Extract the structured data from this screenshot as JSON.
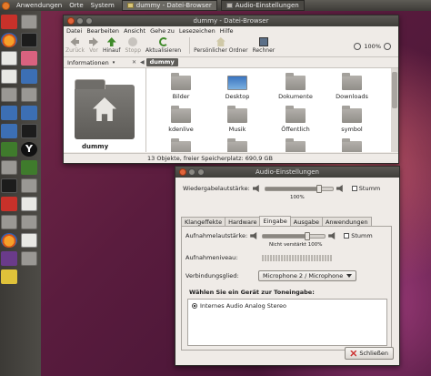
{
  "top_panel": {
    "menus": [
      "Anwendungen",
      "Orte",
      "System"
    ],
    "tasks": [
      {
        "label": "dummy - Datei-Browser",
        "active": true
      },
      {
        "label": "Audio-Einstellungen",
        "active": false
      }
    ]
  },
  "file_browser": {
    "title": "dummy - Datei-Browser",
    "menu": [
      "Datei",
      "Bearbeiten",
      "Ansicht",
      "Gehe zu",
      "Lesezeichen",
      "Hilfe"
    ],
    "toolbar": {
      "back": "Zurück",
      "forward": "Vor",
      "up": "Hinauf",
      "stop": "Stopp",
      "reload": "Aktualisieren",
      "home": "Persönlicher Ordner",
      "computer": "Rechner",
      "zoom": "100%"
    },
    "side_label": "Informationen",
    "breadcrumb": "dummy",
    "side_caption": "dummy",
    "files": [
      {
        "name": "Bilder",
        "icon": "folder-icon"
      },
      {
        "name": "Desktop",
        "icon": "image-folder-icon"
      },
      {
        "name": "Dokumente",
        "icon": "folder-icon"
      },
      {
        "name": "Downloads",
        "icon": "folder-icon"
      },
      {
        "name": "kdenlive",
        "icon": "folder-icon"
      },
      {
        "name": "Musik",
        "icon": "folder-icon"
      },
      {
        "name": "Öffentlich",
        "icon": "folder-icon"
      },
      {
        "name": "symbol",
        "icon": "folder-icon"
      }
    ],
    "status": "13 Objekte, freier Speicherplatz: 690,9 GB"
  },
  "audio": {
    "title": "Audio-Einstellungen",
    "output_volume_label": "Wiedergabelautstärke:",
    "output_volume_pct": "100%",
    "output_volume_value": 0.8,
    "mute_label": "Stumm",
    "tabs": [
      "Klangeffekte",
      "Hardware",
      "Eingabe",
      "Ausgabe",
      "Anwendungen"
    ],
    "active_tab": "Eingabe",
    "input_volume_label": "Aufnahmelautstärke:",
    "input_volume_caption": "Nicht verstärkt 100%",
    "input_volume_value": 0.72,
    "input_mute_label": "Stumm",
    "input_level_label": "Aufnahmeniveau:",
    "connector_label": "Verbindungsglied:",
    "connector_value": "Microphone 2 / Microphone",
    "device_heading": "Wählen Sie ein Gerät zur Toneingabe:",
    "devices": [
      "Internes Audio Analog Stereo"
    ],
    "close_label": "Schließen"
  }
}
